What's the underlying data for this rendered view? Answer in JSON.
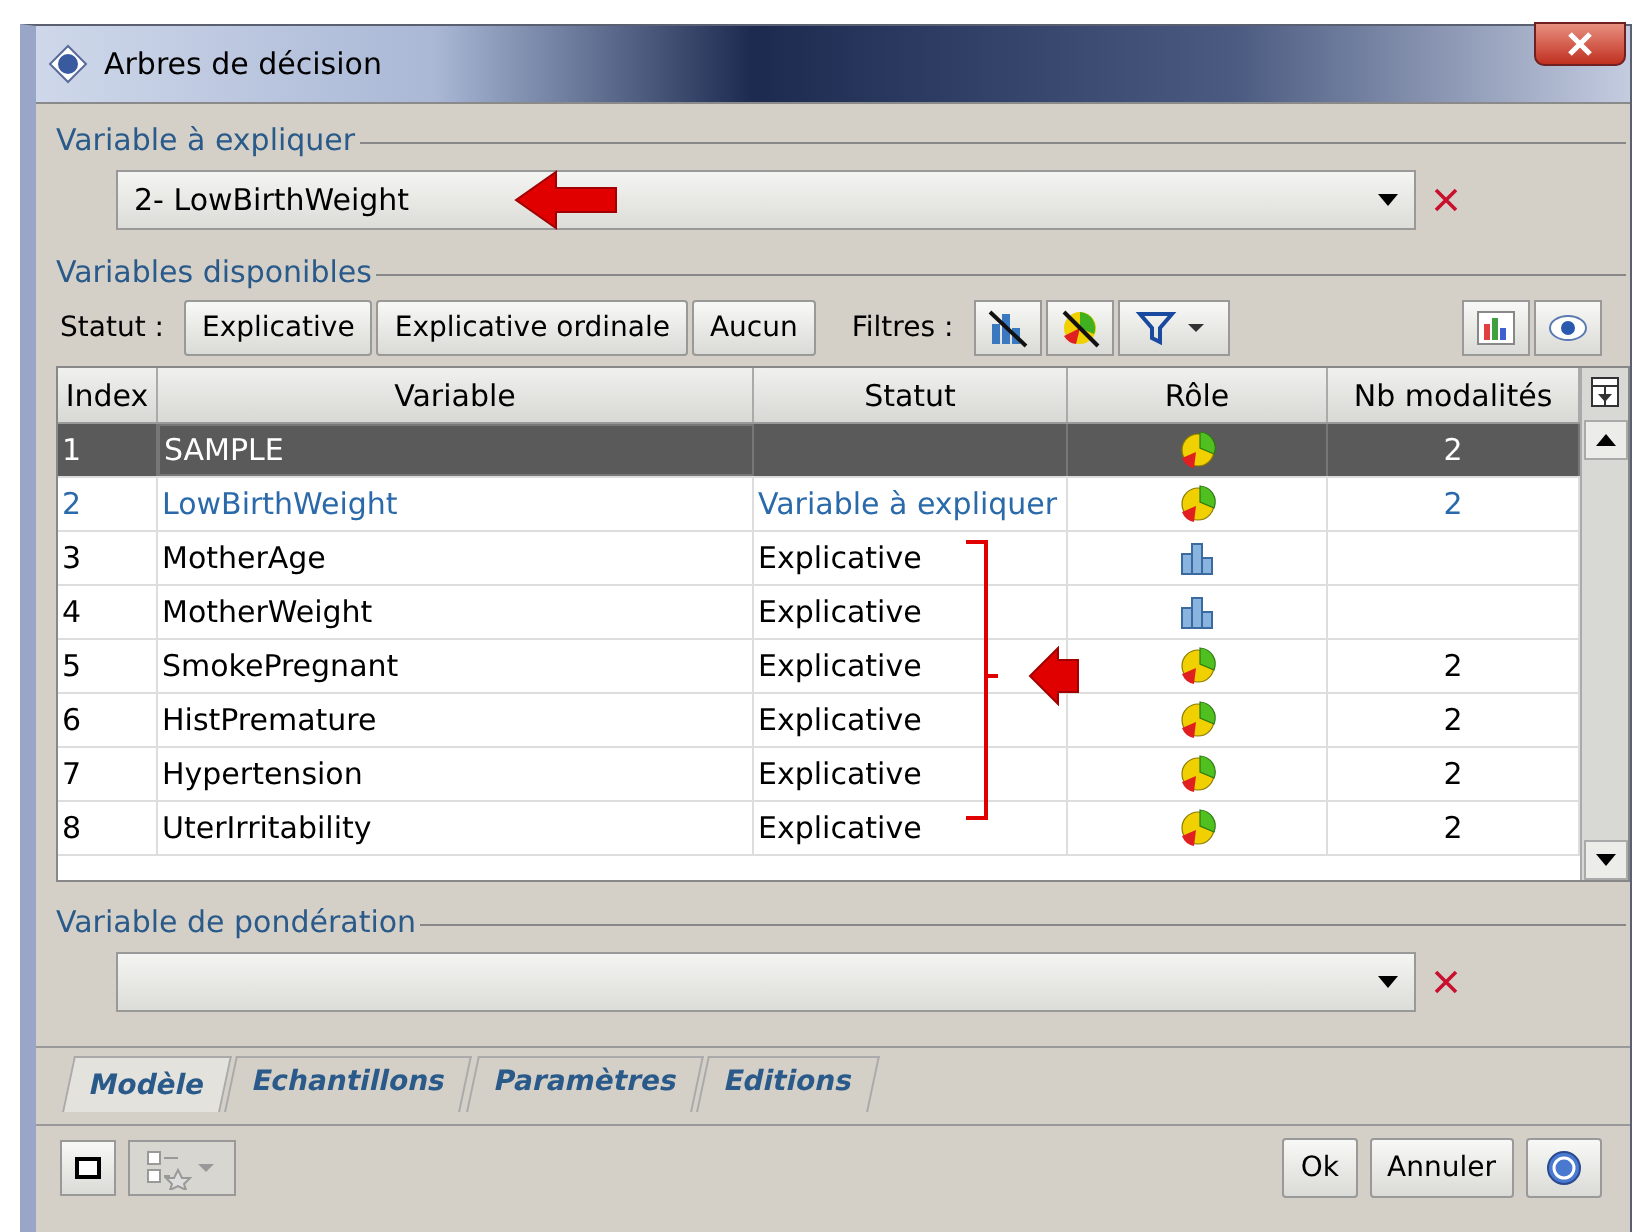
{
  "window": {
    "title": "Arbres de décision"
  },
  "target": {
    "legend": "Variable à expliquer",
    "value": "2- LowBirthWeight"
  },
  "available": {
    "legend": "Variables disponibles",
    "status_label": "Statut :",
    "status_buttons": [
      "Explicative",
      "Explicative ordinale",
      "Aucun"
    ],
    "filters_label": "Filtres :"
  },
  "table": {
    "columns": [
      "Index",
      "Variable",
      "Statut",
      "Rôle",
      "Nb modalités"
    ],
    "rows": [
      {
        "index": "1",
        "variable": "SAMPLE",
        "status": "",
        "kind": "pie",
        "levels": "2",
        "selected": true,
        "target": false
      },
      {
        "index": "2",
        "variable": "LowBirthWeight",
        "status": "Variable à expliquer",
        "kind": "pie",
        "levels": "2",
        "selected": false,
        "target": true
      },
      {
        "index": "3",
        "variable": "MotherAge",
        "status": "Explicative",
        "kind": "bars",
        "levels": "",
        "selected": false,
        "target": false
      },
      {
        "index": "4",
        "variable": "MotherWeight",
        "status": "Explicative",
        "kind": "bars",
        "levels": "",
        "selected": false,
        "target": false
      },
      {
        "index": "5",
        "variable": "SmokePregnant",
        "status": "Explicative",
        "kind": "pie",
        "levels": "2",
        "selected": false,
        "target": false
      },
      {
        "index": "6",
        "variable": "HistPremature",
        "status": "Explicative",
        "kind": "pie",
        "levels": "2",
        "selected": false,
        "target": false
      },
      {
        "index": "7",
        "variable": "Hypertension",
        "status": "Explicative",
        "kind": "pie",
        "levels": "2",
        "selected": false,
        "target": false
      },
      {
        "index": "8",
        "variable": "UterIrritability",
        "status": "Explicative",
        "kind": "pie",
        "levels": "2",
        "selected": false,
        "target": false
      }
    ]
  },
  "weight": {
    "legend": "Variable de pondération"
  },
  "tabs": [
    {
      "label": "Modèle",
      "selected": true
    },
    {
      "label": "Echantillons",
      "selected": false
    },
    {
      "label": "Paramètres",
      "selected": false
    },
    {
      "label": "Editions",
      "selected": false
    }
  ],
  "buttons": [
    "Ok",
    "Annuler"
  ]
}
